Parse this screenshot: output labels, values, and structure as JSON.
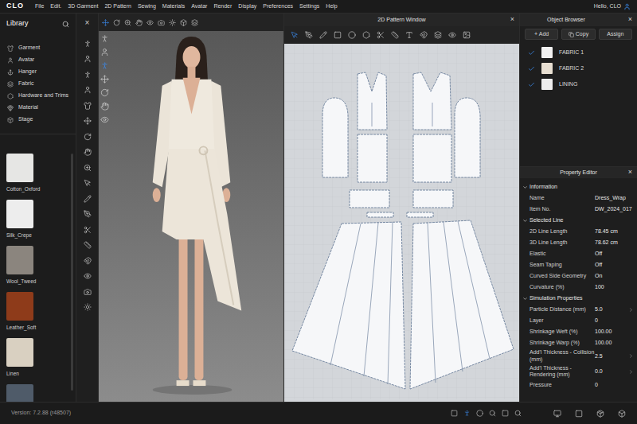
{
  "app": {
    "logo": "CLO",
    "user": "Hello, CLO",
    "version": "Version: 7.2.88 (r48507)"
  },
  "menu": [
    "File",
    "Edit.",
    "3D Garment",
    "2D Pattern",
    "Sewing",
    "Materials",
    "Avatar",
    "Render",
    "Display",
    "Preferences",
    "Settings",
    "Help"
  ],
  "library": {
    "title": "Library",
    "categories": [
      "Garment",
      "Avatar",
      "Hanger",
      "Fabric",
      "Hardware and Trims",
      "Material",
      "Stage"
    ],
    "materials": [
      {
        "name": "Cotton_Oxford",
        "color": "#e6e6e4"
      },
      {
        "name": "Silk_Crepe",
        "color": "#ededed"
      },
      {
        "name": "Wool_Tweed",
        "color": "#8b857e"
      },
      {
        "name": "Leather_Soft",
        "color": "#8e3b1a"
      },
      {
        "name": "Linen",
        "color": "#d9d0c1"
      },
      {
        "color": "#4f5b69"
      }
    ]
  },
  "toolbox": {
    "close": "×"
  },
  "viewport": {
    "toolbar": [
      {
        "selected": true
      },
      {
        "selected": false
      },
      {
        "selected": false
      },
      {
        "selected": false
      },
      {
        "selected": false
      },
      {
        "selected": false
      },
      {
        "selected": false
      },
      {
        "selected": false
      },
      {
        "selected": false
      }
    ],
    "side_tools": [
      {
        "selected": false
      },
      {
        "selected": false
      },
      {
        "selected": true
      },
      {
        "selected": false
      },
      {
        "selected": false
      },
      {
        "selected": false
      },
      {
        "selected": false
      }
    ]
  },
  "pattern_window": {
    "title": "2D Pattern Window",
    "close": "×",
    "toolbar": [
      {
        "selected": true
      },
      {
        "selected": false
      },
      {
        "selected": false
      },
      {
        "selected": false
      },
      {
        "selected": false
      },
      {
        "selected": false
      },
      {
        "selected": false
      },
      {
        "selected": false
      },
      {
        "selected": false
      },
      {
        "selected": false
      },
      {
        "selected": false
      },
      {
        "selected": false
      },
      {
        "selected": false
      }
    ]
  },
  "object_browser": {
    "title": "Object Browser",
    "close": "×",
    "buttons": [
      "+ Add",
      "Copy",
      "Assign"
    ],
    "fabrics": [
      {
        "name": "FABRIC 1",
        "checked": true,
        "color": "#f2f2f2"
      },
      {
        "name": "FABRIC 2",
        "checked": true,
        "color": "#e8dfd2"
      },
      {
        "name": "LINING",
        "checked": true,
        "color": "#eeeeee"
      }
    ]
  },
  "property_editor": {
    "title": "Property Editor",
    "close": "×",
    "sections": [
      {
        "title": "Information",
        "expanded": true,
        "rows": [
          {
            "label": "Name",
            "value": "Dress_Wrap",
            "arrow": false
          },
          {
            "label": "Item No.",
            "value": "DW_2024_017",
            "arrow": false
          }
        ]
      },
      {
        "title": "Selected Line",
        "expanded": true,
        "rows": [
          {
            "label": "2D Line Length",
            "value": "78.45 cm",
            "arrow": false
          },
          {
            "label": "3D Line Length",
            "value": "78.62 cm",
            "arrow": false
          },
          {
            "label": "Elastic",
            "value": "Off",
            "arrow": false
          },
          {
            "label": "Seam Taping",
            "value": "Off",
            "arrow": false
          },
          {
            "label": "Curved Side Geometry",
            "value": "On",
            "arrow": false
          },
          {
            "label": "Curvature (%)",
            "value": "100",
            "arrow": false
          }
        ]
      },
      {
        "title": "Simulation Properties",
        "expanded": true,
        "rows": [
          {
            "label": "Particle Distance (mm)",
            "value": "5.0",
            "arrow": true
          },
          {
            "label": "Layer",
            "value": "0",
            "arrow": false
          },
          {
            "label": "Shrinkage Weft (%)",
            "value": "100.00",
            "arrow": false
          },
          {
            "label": "Shrinkage Warp (%)",
            "value": "100.00",
            "arrow": false
          },
          {
            "label": "Add'l Thickness - Collision (mm)",
            "value": "2.5",
            "arrow": true
          },
          {
            "label": "Add'l Thickness - Rendering (mm)",
            "value": "0.0",
            "arrow": true
          },
          {
            "label": "Pressure",
            "value": "0",
            "arrow": false
          }
        ]
      }
    ]
  },
  "status_bar": {
    "tools": [
      {
        "selected": false
      },
      {
        "selected": true
      },
      {
        "selected": false
      },
      {
        "selected": false
      },
      {
        "selected": false
      },
      {
        "selected": false
      },
      {
        "selected": false
      },
      {
        "selected": false
      },
      {
        "selected": false
      },
      {
        "selected": false
      }
    ]
  }
}
